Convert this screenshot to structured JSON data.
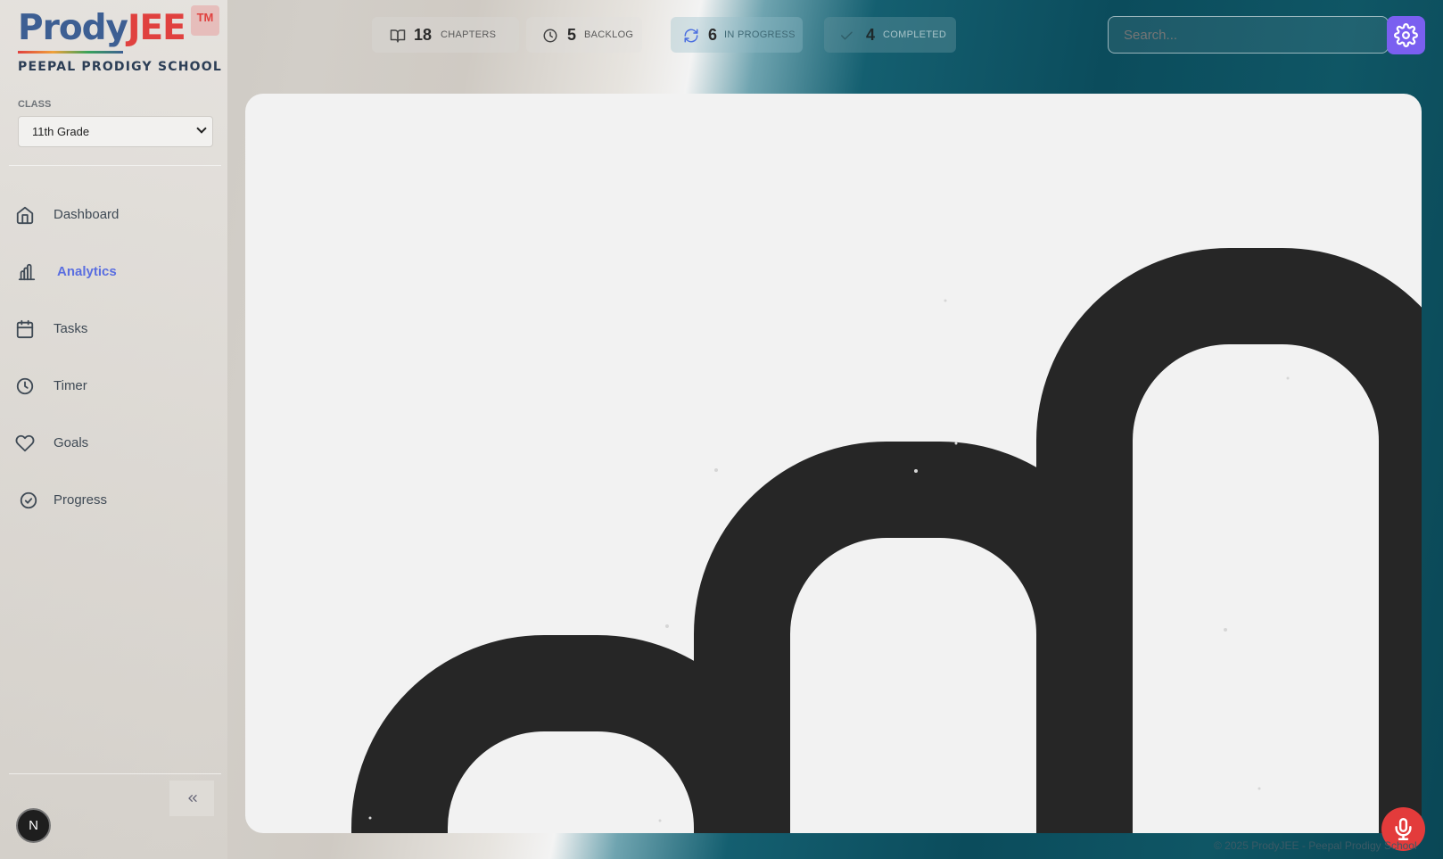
{
  "brand": {
    "name_part1": "Prody",
    "name_part2": "JEE",
    "tm": "TM",
    "school": "PEEPAL PRODIGY SCHOOL"
  },
  "class_selector": {
    "label": "CLASS",
    "value": "11th Grade"
  },
  "nav": {
    "items": [
      {
        "label": "Dashboard",
        "icon": "home-icon"
      },
      {
        "label": "Analytics",
        "icon": "bar-chart-icon",
        "active": true
      },
      {
        "label": "Tasks",
        "icon": "calendar-icon"
      },
      {
        "label": "Timer",
        "icon": "clock-icon"
      },
      {
        "label": "Goals",
        "icon": "heart-icon"
      },
      {
        "label": "Progress",
        "icon": "check-circle-icon"
      }
    ]
  },
  "stats": [
    {
      "value": "18",
      "label": "CHAPTERS",
      "icon": "book-icon"
    },
    {
      "value": "5",
      "label": "BACKLOG",
      "icon": "clock-icon"
    },
    {
      "value": "6",
      "label": "IN PROGRESS",
      "icon": "refresh-icon"
    },
    {
      "value": "4",
      "label": "COMPLETED",
      "icon": "check-icon"
    }
  ],
  "search": {
    "placeholder": "Search..."
  },
  "user": {
    "initial": "N"
  },
  "footer": {
    "text": "© 2025 ProdyJEE - Peepal Prodigy School"
  },
  "colors": {
    "accent": "#7a5ff0",
    "active_nav": "#5a6ee0",
    "mic": "#e33b3b",
    "brand_blue": "#3d5f93",
    "brand_red": "#e0413f"
  }
}
